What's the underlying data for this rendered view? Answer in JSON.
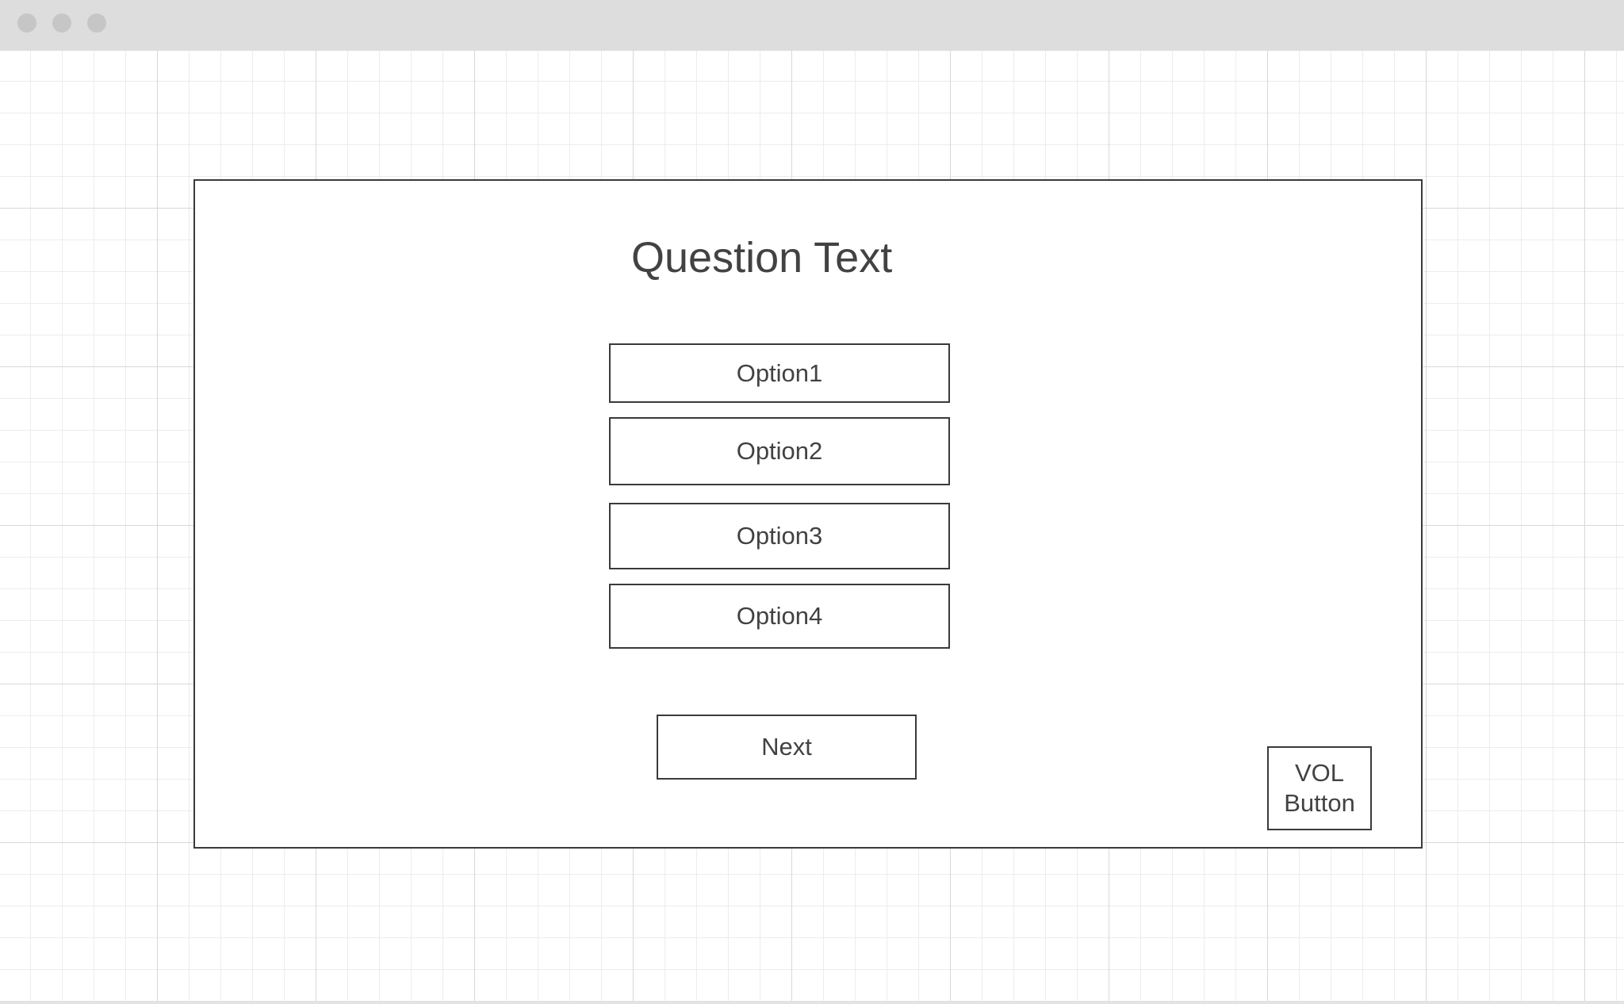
{
  "window": {
    "controls": [
      "close-dot",
      "minimize-dot",
      "maximize-dot"
    ]
  },
  "quiz": {
    "question": "Question Text",
    "options": [
      "Option1",
      "Option2",
      "Option3",
      "Option4"
    ],
    "next_label": "Next",
    "vol_label_line1": "VOL",
    "vol_label_line2": "Button"
  }
}
